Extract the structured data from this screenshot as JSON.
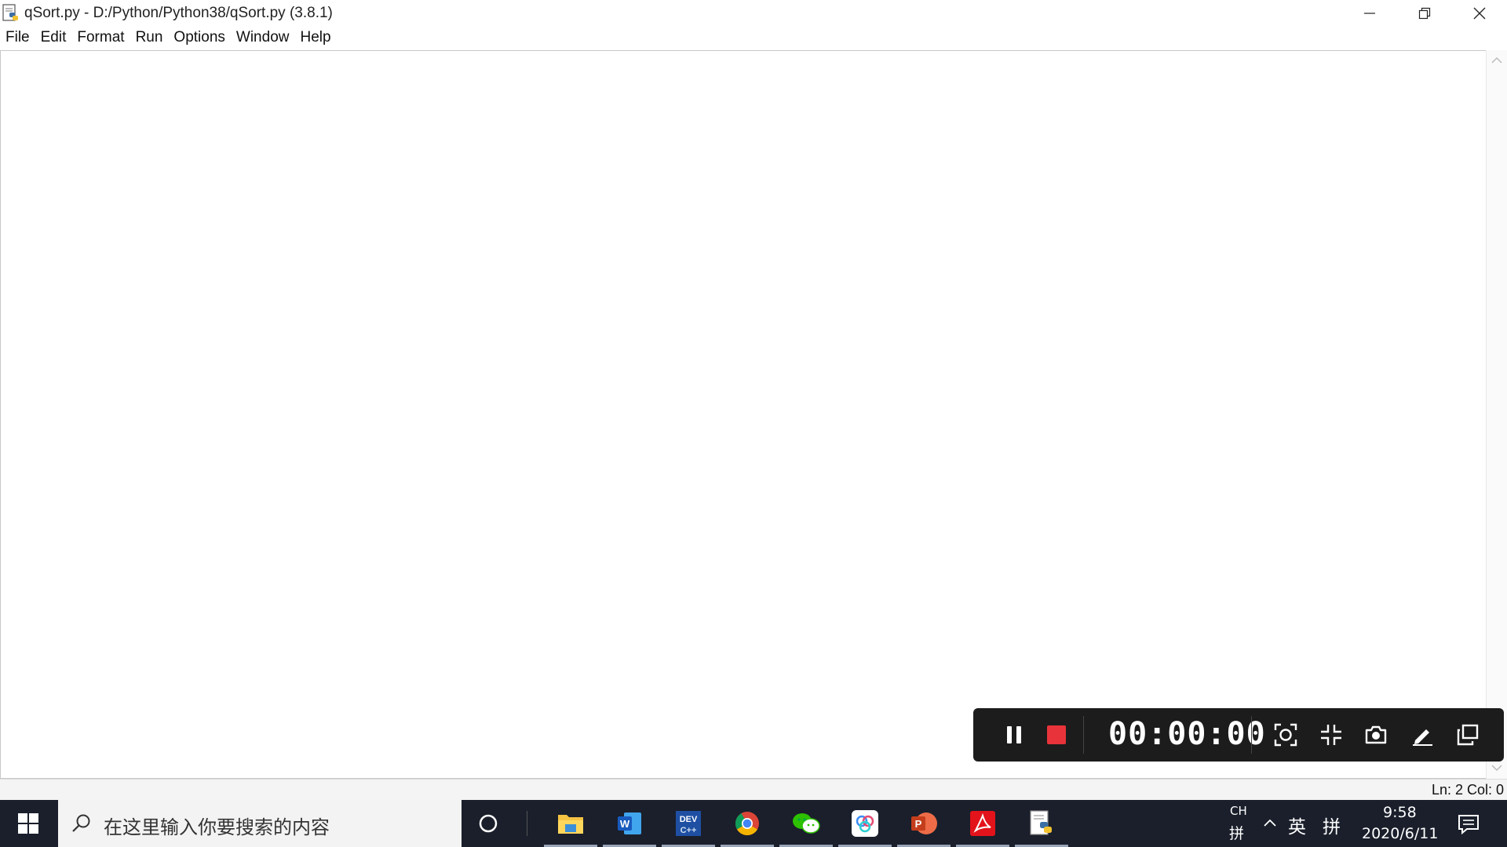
{
  "window": {
    "title": "qSort.py - D:/Python/Python38/qSort.py (3.8.1)"
  },
  "menu": [
    "File",
    "Edit",
    "Format",
    "Run",
    "Options",
    "Window",
    "Help"
  ],
  "status": {
    "position": "Ln: 2  Col: 0"
  },
  "recorder": {
    "timer": "00:00:00",
    "buttons": [
      "pause-icon",
      "stop-icon",
      "screenshot-region-icon",
      "shrink-icon",
      "camera-icon",
      "pen-icon",
      "window-icon"
    ]
  },
  "taskbar": {
    "search_placeholder": "在这里输入你要搜索的内容",
    "apps": [
      "file-explorer-icon",
      "word-icon",
      "devcpp-icon",
      "chrome-icon",
      "wechat-icon",
      "baidu-netdisk-icon",
      "powerpoint-icon",
      "acrobat-icon",
      "python-idle-icon"
    ],
    "tray": {
      "lang_top": "CH",
      "lang_bottom": "拼",
      "ime_mode": "英",
      "ime_layout": "拼",
      "time": "9:58",
      "date": "2020/6/11"
    }
  },
  "colors": {
    "taskbar": "#1a1f2b",
    "recorder": "#1c1c1c",
    "stop": "#e8333a"
  }
}
